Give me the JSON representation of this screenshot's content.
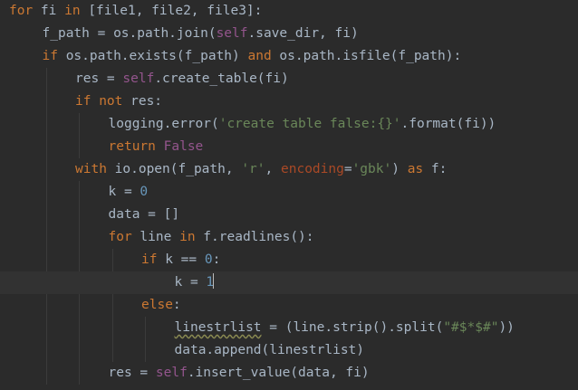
{
  "editor": {
    "lines": [
      {
        "indent": 0,
        "tokens": [
          [
            "kw",
            "for"
          ],
          [
            "id",
            " fi "
          ],
          [
            "kw",
            "in"
          ],
          [
            "id",
            " [file1, file2, file3]:"
          ]
        ]
      },
      {
        "indent": 1,
        "tokens": [
          [
            "id",
            "f_path = os.path.join("
          ],
          [
            "self",
            "self"
          ],
          [
            "id",
            ".save_dir, fi)"
          ]
        ]
      },
      {
        "indent": 1,
        "tokens": [
          [
            "kw",
            "if"
          ],
          [
            "id",
            " os.path.exists(f_path) "
          ],
          [
            "kw",
            "and"
          ],
          [
            "id",
            " os.path.isfile(f_path):"
          ]
        ]
      },
      {
        "indent": 2,
        "tokens": [
          [
            "id",
            "res = "
          ],
          [
            "self",
            "self"
          ],
          [
            "id",
            ".create_table(fi)"
          ]
        ]
      },
      {
        "indent": 2,
        "tokens": [
          [
            "kw",
            "if not"
          ],
          [
            "id",
            " res:"
          ]
        ]
      },
      {
        "indent": 3,
        "tokens": [
          [
            "id",
            "logging.error("
          ],
          [
            "str",
            "'create table false:{}'"
          ],
          [
            "id",
            ".format(fi))"
          ]
        ]
      },
      {
        "indent": 3,
        "tokens": [
          [
            "kw",
            "return"
          ],
          [
            "id",
            " "
          ],
          [
            "self",
            "False"
          ]
        ]
      },
      {
        "indent": 2,
        "tokens": [
          [
            "kw",
            "with"
          ],
          [
            "id",
            " io.open(f_path, "
          ],
          [
            "str",
            "'r'"
          ],
          [
            "id",
            ", "
          ],
          [
            "param",
            "encoding"
          ],
          [
            "id",
            "="
          ],
          [
            "str",
            "'gbk'"
          ],
          [
            "id",
            ") "
          ],
          [
            "kw",
            "as"
          ],
          [
            "id",
            " f:"
          ]
        ]
      },
      {
        "indent": 3,
        "tokens": [
          [
            "id",
            "k = "
          ],
          [
            "num",
            "0"
          ]
        ]
      },
      {
        "indent": 3,
        "tokens": [
          [
            "id",
            "data = []"
          ]
        ]
      },
      {
        "indent": 3,
        "tokens": [
          [
            "kw",
            "for"
          ],
          [
            "id",
            " line "
          ],
          [
            "kw",
            "in"
          ],
          [
            "id",
            " f.readlines():"
          ]
        ]
      },
      {
        "indent": 4,
        "tokens": [
          [
            "kw",
            "if"
          ],
          [
            "id",
            " k == "
          ],
          [
            "num",
            "0"
          ],
          [
            "id",
            ":"
          ]
        ]
      },
      {
        "indent": 5,
        "current": true,
        "tokens": [
          [
            "id",
            "k = "
          ],
          [
            "num",
            "1"
          ]
        ]
      },
      {
        "indent": 4,
        "tokens": [
          [
            "kw",
            "else"
          ],
          [
            "id",
            ":"
          ]
        ]
      },
      {
        "indent": 5,
        "tokens": [
          [
            "warn",
            "linestrlist"
          ],
          [
            "id",
            " = (line.strip().split("
          ],
          [
            "str",
            "\"#$*$#\""
          ],
          [
            "id",
            "))"
          ]
        ]
      },
      {
        "indent": 5,
        "tokens": [
          [
            "id",
            "data.append(linestrlist)"
          ]
        ]
      },
      {
        "indent": 3,
        "tokens": [
          [
            "id",
            "res = "
          ],
          [
            "self",
            "self"
          ],
          [
            "id",
            ".insert_value(data, fi)"
          ]
        ]
      }
    ]
  },
  "colors": {
    "background": "#2b2b2b",
    "current_line": "#323232",
    "keyword": "#cc7832",
    "self": "#94558d",
    "number": "#6897bb",
    "string": "#6a8759",
    "param": "#aa4926",
    "identifier": "#a9b7c6"
  }
}
